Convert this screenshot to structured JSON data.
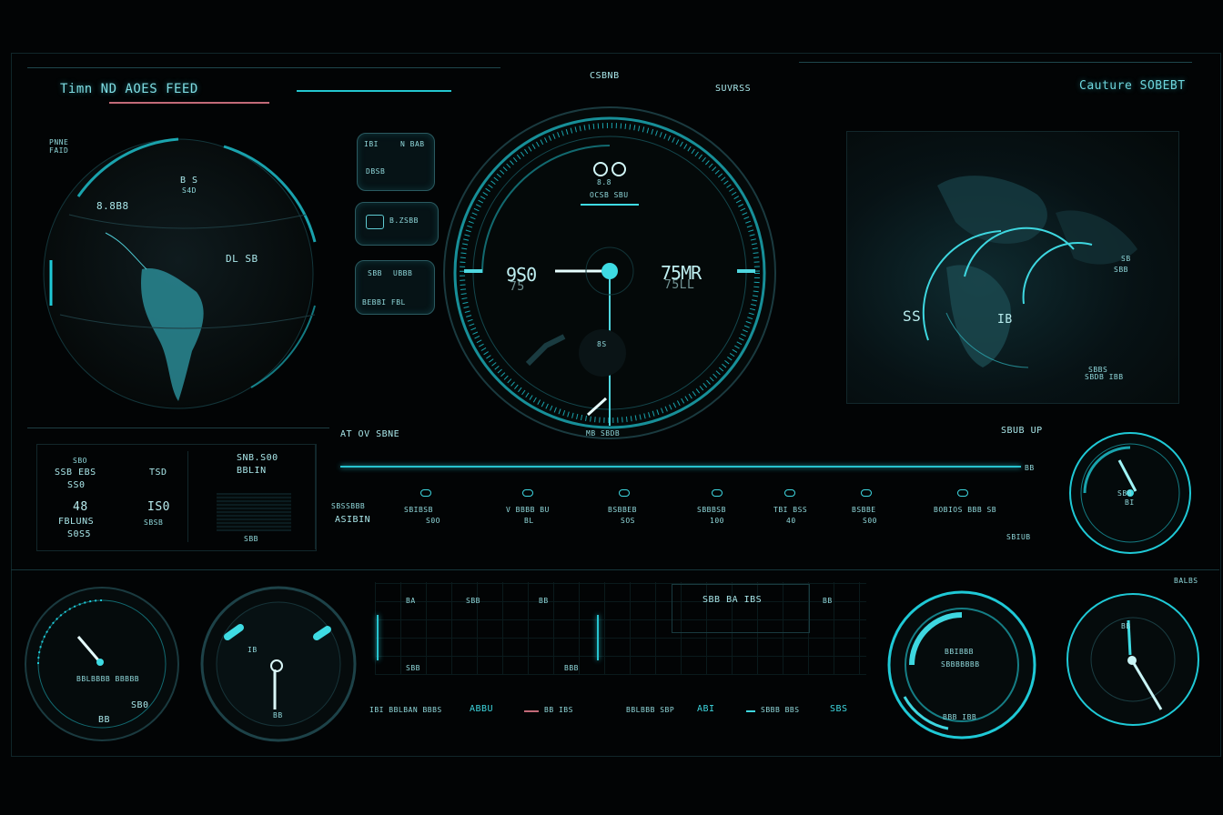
{
  "header": {
    "title": "Timn ND AOES FEED",
    "center_label": "CSBNB",
    "center_sub": "SUVRSS",
    "right_label": "Cauture SOBEBT"
  },
  "globe_panel": {
    "corner_label": "PNNE FAID",
    "label_a": "8.8B8",
    "label_b": "B S",
    "label_b2": "S4D",
    "label_c": "DL SB"
  },
  "side_buttons": [
    {
      "top": "IBI",
      "main": "N BAB"
    },
    {
      "top": "DBSB",
      "main": ""
    },
    {
      "top": "",
      "main": "B.ZSBB"
    },
    {
      "top": "SBB",
      "main": "UBBB"
    },
    {
      "top": "",
      "main": "BEBBI FBL"
    }
  ],
  "main_dial": {
    "top_icon": "8.8",
    "top_label": "OCSB SBU",
    "left_value": "9S0",
    "left_sub": "75",
    "right_value": "75MR",
    "right_sub": "75LL",
    "bottom_label": "MB SBDB",
    "mini_label": "8S"
  },
  "map_panel": {
    "label_left": "SS",
    "label_right": "IB",
    "label_top_right": "SB",
    "label_top_right2": "SBB",
    "label_bottom": "SBBS",
    "label_bottom2": "SBDB IBB"
  },
  "stats_panel": {
    "items": [
      {
        "k": "SBO",
        "v": "SSB EBS",
        "n": "SS0"
      },
      {
        "k": "",
        "v": "TSD",
        "n": ""
      },
      {
        "k": "48",
        "v": "FBLUNS",
        "n": "S0S5"
      },
      {
        "k": "",
        "v": "IS0",
        "n": "SBSB"
      }
    ],
    "headline": "SNB.S00",
    "headline_sub": "BBLIN",
    "sub_caption": "SBB"
  },
  "readout_row": {
    "title": "AT OV SBNE",
    "right_title": "SBUB UP",
    "end_label": "BB",
    "footer_right": "SBIUB",
    "items": [
      {
        "icon": "SBSSBBB",
        "label": "ASIBIN",
        "value": ""
      },
      {
        "icon": "SBIBSB",
        "label": "",
        "value": "S0O"
      },
      {
        "icon": "V BBBB BU",
        "label": "",
        "value": "BL"
      },
      {
        "icon": "BSBBEB",
        "label": "",
        "value": "SOS"
      },
      {
        "icon": "SBBBSB",
        "label": "",
        "value": "100"
      },
      {
        "icon": "TBI BSS",
        "label": "",
        "value": "40"
      },
      {
        "icon": "BSBBE",
        "label": "",
        "value": "S00"
      },
      {
        "icon": "BOBIOS BBB SB",
        "label": "",
        "value": ""
      }
    ]
  },
  "right_gauge": {
    "label_top": "SBB",
    "label_bottom": "BI"
  },
  "bottom": {
    "gauge1": {
      "label": "BBLBBBB BBBBB",
      "value": "SB0",
      "value2": "BB"
    },
    "gauge2": {
      "label_mid": "IB",
      "label_bottom": "BB"
    },
    "chart_labels": [
      "BA",
      "SBB",
      "BB",
      "BB",
      "SBB",
      "BBB"
    ],
    "chart_title": "SBB BA IBS",
    "footer": [
      "IBI BBLBAN BBBS",
      "ABBU",
      "BB IBS",
      "BBLBBB SBP",
      "ABI",
      "SBBB BBS",
      "SBS"
    ],
    "gauge3": {
      "label": "BBIBBB",
      "label2": "SBBBBBBB",
      "label3": "BBB IBB"
    },
    "gauge4": {
      "label_top": "BALBS",
      "label_mid": "BB"
    }
  }
}
